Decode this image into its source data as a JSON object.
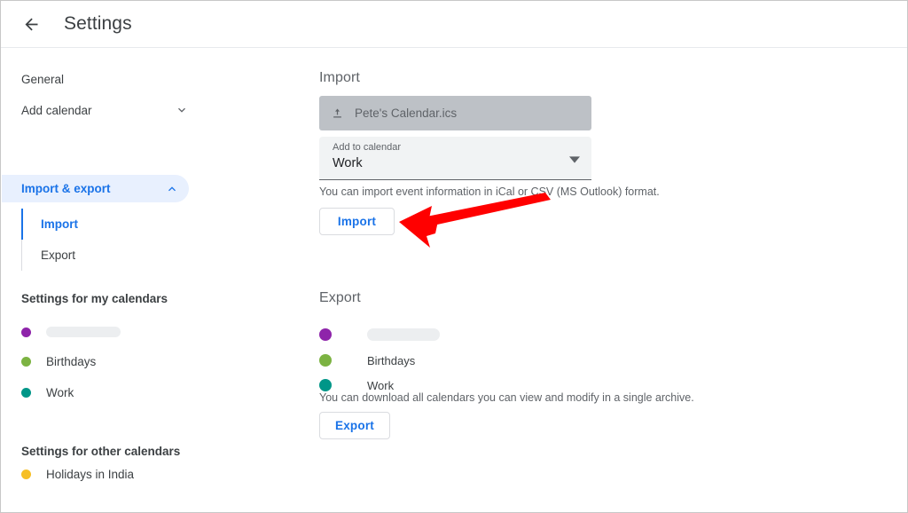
{
  "header": {
    "back_icon": "arrow-left-icon",
    "title": "Settings"
  },
  "sidebar": {
    "items": [
      {
        "label": "General",
        "icon": null
      },
      {
        "label": "Add calendar",
        "icon": "chevron-down-icon"
      },
      {
        "label": "Import & export",
        "icon": "chevron-up-icon",
        "active": true
      }
    ],
    "subitems": [
      {
        "label": "Import",
        "active": true
      },
      {
        "label": "Export",
        "active": false
      }
    ],
    "my_calendars_heading": "Settings for my calendars",
    "my_calendars": [
      {
        "name": "",
        "redacted": true,
        "color": "#8E24AA"
      },
      {
        "name": "Birthdays",
        "redacted": false,
        "color": "#7CB342"
      },
      {
        "name": "Work",
        "redacted": false,
        "color": "#009688"
      }
    ],
    "other_calendars_heading": "Settings for other calendars",
    "other_calendars": [
      {
        "name": "Holidays in India",
        "redacted": false,
        "color": "#F6BF26"
      }
    ]
  },
  "import": {
    "title": "Import",
    "file_chip": {
      "icon": "upload-icon",
      "filename": "Pete's Calendar.ics"
    },
    "select": {
      "label": "Add to calendar",
      "value": "Work",
      "icon": "dropdown-arrow-icon"
    },
    "help_text": "You can import event information in iCal or CSV (MS Outlook) format.",
    "button_label": "Import"
  },
  "export": {
    "title": "Export",
    "calendars": [
      {
        "name": "",
        "redacted": true,
        "color": "#8E24AA"
      },
      {
        "name": "Birthdays",
        "redacted": false,
        "color": "#7CB342"
      },
      {
        "name": "Work",
        "redacted": false,
        "color": "#009688"
      }
    ],
    "help_text": "You can download all calendars you can view and modify in a single archive.",
    "button_label": "Export"
  },
  "annotation": {
    "arrow_color": "#FF0000",
    "points_to": "Import"
  },
  "colors": {
    "accent": "#1a73e8",
    "active_pill": "#e8f0fe",
    "chip_bg": "#bdc1c6",
    "field_bg": "#f1f3f4",
    "text_primary": "#3c4043",
    "text_secondary": "#5f6368"
  }
}
